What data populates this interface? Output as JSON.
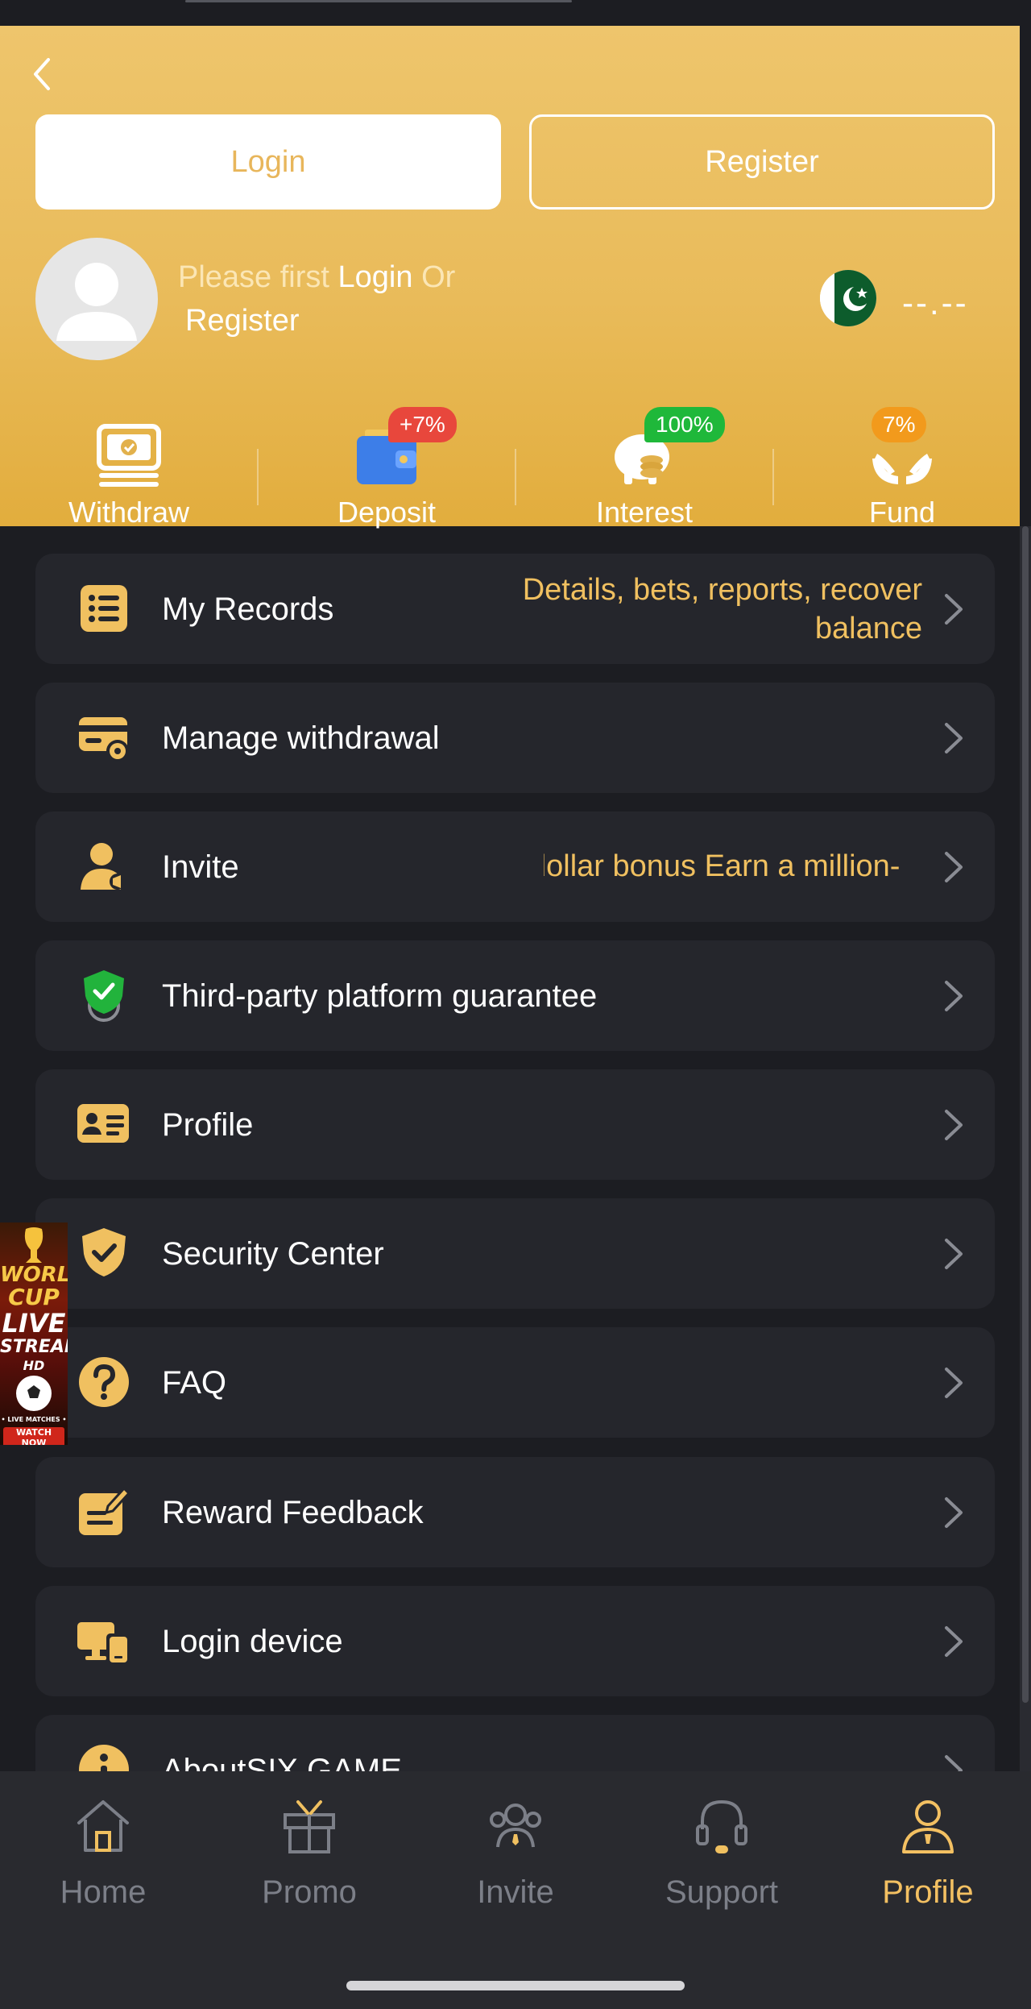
{
  "header": {
    "login_button": "Login",
    "register_button": "Register",
    "prompt_prefix": "Please first ",
    "prompt_login": "Login",
    "prompt_or": " Or",
    "prompt_register": "Register",
    "balance": "--.--",
    "flag": "pakistan-flag-icon"
  },
  "quick_actions": [
    {
      "label": "Withdraw",
      "icon": "money-icon"
    },
    {
      "label": "Deposit",
      "icon": "wallet-icon",
      "badge": "+7%",
      "badge_color": "#e8473c"
    },
    {
      "label": "Interest",
      "icon": "piggy-bank-icon",
      "badge": "100%",
      "badge_color": "#1fb83a"
    },
    {
      "label": "Fund",
      "icon": "hands-icon",
      "badge": "7%",
      "badge_color": "#f29a1c"
    }
  ],
  "menu": [
    {
      "label": "My Records",
      "subtitle": "Details, bets, reports, recover balance",
      "icon": "list-icon"
    },
    {
      "label": "Manage withdrawal",
      "icon": "card-gear-icon"
    },
    {
      "label": "Invite",
      "marquee": "dollar bonus  Earn a million-",
      "icon": "user-megaphone-icon"
    },
    {
      "label": "Third-party platform guarantee",
      "icon": "shield-check-icon"
    },
    {
      "label": "Profile",
      "icon": "id-card-icon"
    },
    {
      "label": "Security Center",
      "icon": "security-shield-icon"
    },
    {
      "label": "FAQ",
      "icon": "question-icon"
    },
    {
      "label": "Reward Feedback",
      "icon": "edit-note-icon"
    },
    {
      "label": "Login device",
      "icon": "devices-icon"
    },
    {
      "label": "AboutSIX GAME",
      "icon": "info-icon"
    }
  ],
  "promo_banner": {
    "line1": "WORLD",
    "line2": "CUP",
    "line3": "LIVE",
    "line4": "STREAM",
    "line5": "HD",
    "line6": "• LIVE MATCHES •",
    "cta": "WATCH NOW"
  },
  "tabs": [
    {
      "label": "Home",
      "icon": "home-icon"
    },
    {
      "label": "Promo",
      "icon": "gift-icon"
    },
    {
      "label": "Invite",
      "icon": "users-icon"
    },
    {
      "label": "Support",
      "icon": "headset-icon"
    },
    {
      "label": "Profile",
      "icon": "person-icon",
      "active": true
    }
  ],
  "colors": {
    "accent": "#f0c060",
    "header_gold": "#eac064",
    "background": "#1c1d22",
    "row_bg": "#25262c"
  }
}
